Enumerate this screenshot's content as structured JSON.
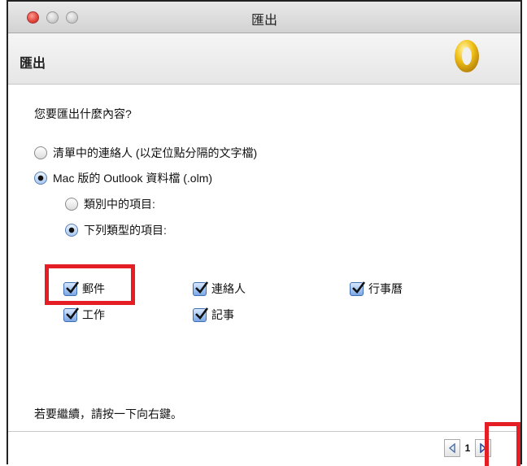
{
  "window": {
    "title": "匯出"
  },
  "header": {
    "title": "匯出",
    "logo_icon": "outlook-icon"
  },
  "question": "您要匯出什麼內容?",
  "options": [
    {
      "label": "清單中的連絡人 (以定位點分隔的文字檔)",
      "selected": false
    },
    {
      "label": "Mac 版的 Outlook 資料檔 (.olm)",
      "selected": true
    }
  ],
  "sub_options": [
    {
      "label": "類別中的項目:",
      "selected": false
    },
    {
      "label": "下列類型的項目:",
      "selected": true
    }
  ],
  "item_types": [
    {
      "label": "郵件",
      "checked": true
    },
    {
      "label": "連絡人",
      "checked": true
    },
    {
      "label": "行事曆",
      "checked": true
    },
    {
      "label": "工作",
      "checked": true
    },
    {
      "label": "記事",
      "checked": true
    }
  ],
  "footer": {
    "instruction": "若要繼續，請按一下向右鍵。",
    "page": "1"
  },
  "colors": {
    "highlight": "#e51e25",
    "accent": "#3f6fb2"
  }
}
